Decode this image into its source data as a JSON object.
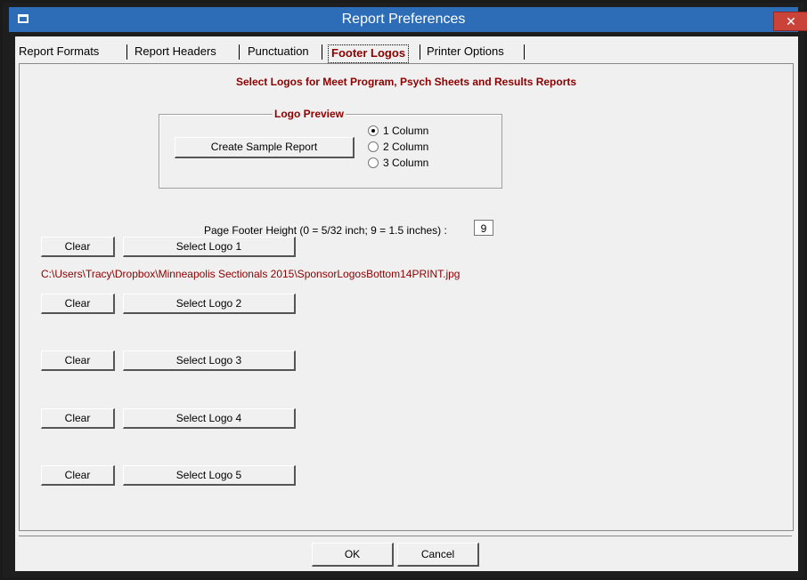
{
  "window": {
    "title": "Report Preferences",
    "close_glyph": "✕",
    "icon": "app-window-icon"
  },
  "tabs": [
    {
      "label": "Report Formats",
      "active": false
    },
    {
      "label": "Report Headers",
      "active": false
    },
    {
      "label": "Punctuation",
      "active": false
    },
    {
      "label": "Footer Logos",
      "active": true
    },
    {
      "label": "Printer Options",
      "active": false
    }
  ],
  "panel": {
    "heading": "Select Logos for Meet Program, Psych Sheets and Results Reports",
    "preview": {
      "legend": "Logo Preview",
      "create_button": "Create Sample Report",
      "options": [
        {
          "label": "1 Column",
          "selected": true
        },
        {
          "label": "2 Column",
          "selected": false
        },
        {
          "label": "3 Column",
          "selected": false
        }
      ]
    },
    "footer_height": {
      "label": "Page Footer Height (0 = 5/32 inch; 9 = 1.5 inches) :",
      "value": "9"
    },
    "logos": [
      {
        "clear": "Clear",
        "select": "Select Logo 1",
        "path": "C:\\Users\\Tracy\\Dropbox\\Minneapolis Sectionals 2015\\SponsorLogosBottom14PRINT.jpg"
      },
      {
        "clear": "Clear",
        "select": "Select Logo 2",
        "path": ""
      },
      {
        "clear": "Clear",
        "select": "Select Logo 3",
        "path": ""
      },
      {
        "clear": "Clear",
        "select": "Select Logo 4",
        "path": ""
      },
      {
        "clear": "Clear",
        "select": "Select Logo 5",
        "path": ""
      }
    ]
  },
  "buttons": {
    "ok": "OK",
    "cancel": "Cancel"
  },
  "colors": {
    "accent": "#8b0000",
    "titlebar": "#2d6db8",
    "close": "#c9433a",
    "client": "#f0f0f0"
  }
}
